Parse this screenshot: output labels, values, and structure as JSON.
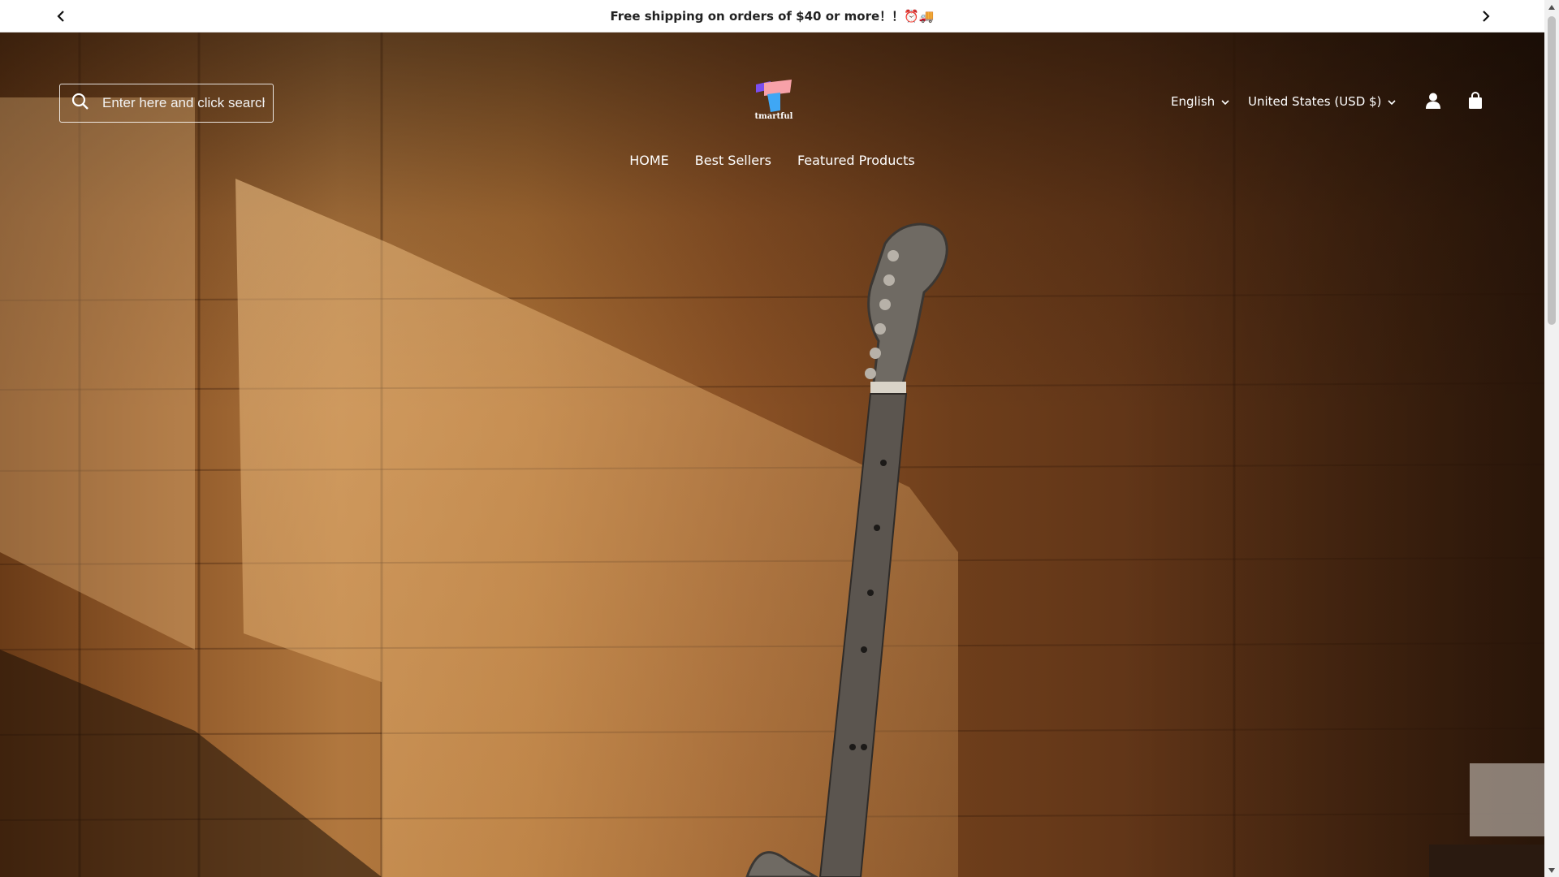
{
  "announcement": {
    "text": "Free shipping on orders of $40 or more！！⏰🚚",
    "prev_icon": "chevron-left-icon",
    "next_icon": "chevron-right-icon"
  },
  "header": {
    "search_placeholder": "Enter here and click search",
    "logo_text": "tmartful",
    "language": "English",
    "country": "United States (USD $)",
    "account_icon": "user-icon",
    "cart_icon": "shopping-bag-icon"
  },
  "nav": {
    "items": [
      {
        "label": "HOME"
      },
      {
        "label": "Best Sellers"
      },
      {
        "label": "Featured Products"
      }
    ]
  },
  "colors": {
    "announcement_bg": "#ffffff",
    "announcement_text": "#222222",
    "header_text": "#ffffff",
    "logo_pink": "#f7a1a8",
    "logo_blue": "#3fa7f5",
    "logo_purple": "#7a4ef0"
  }
}
